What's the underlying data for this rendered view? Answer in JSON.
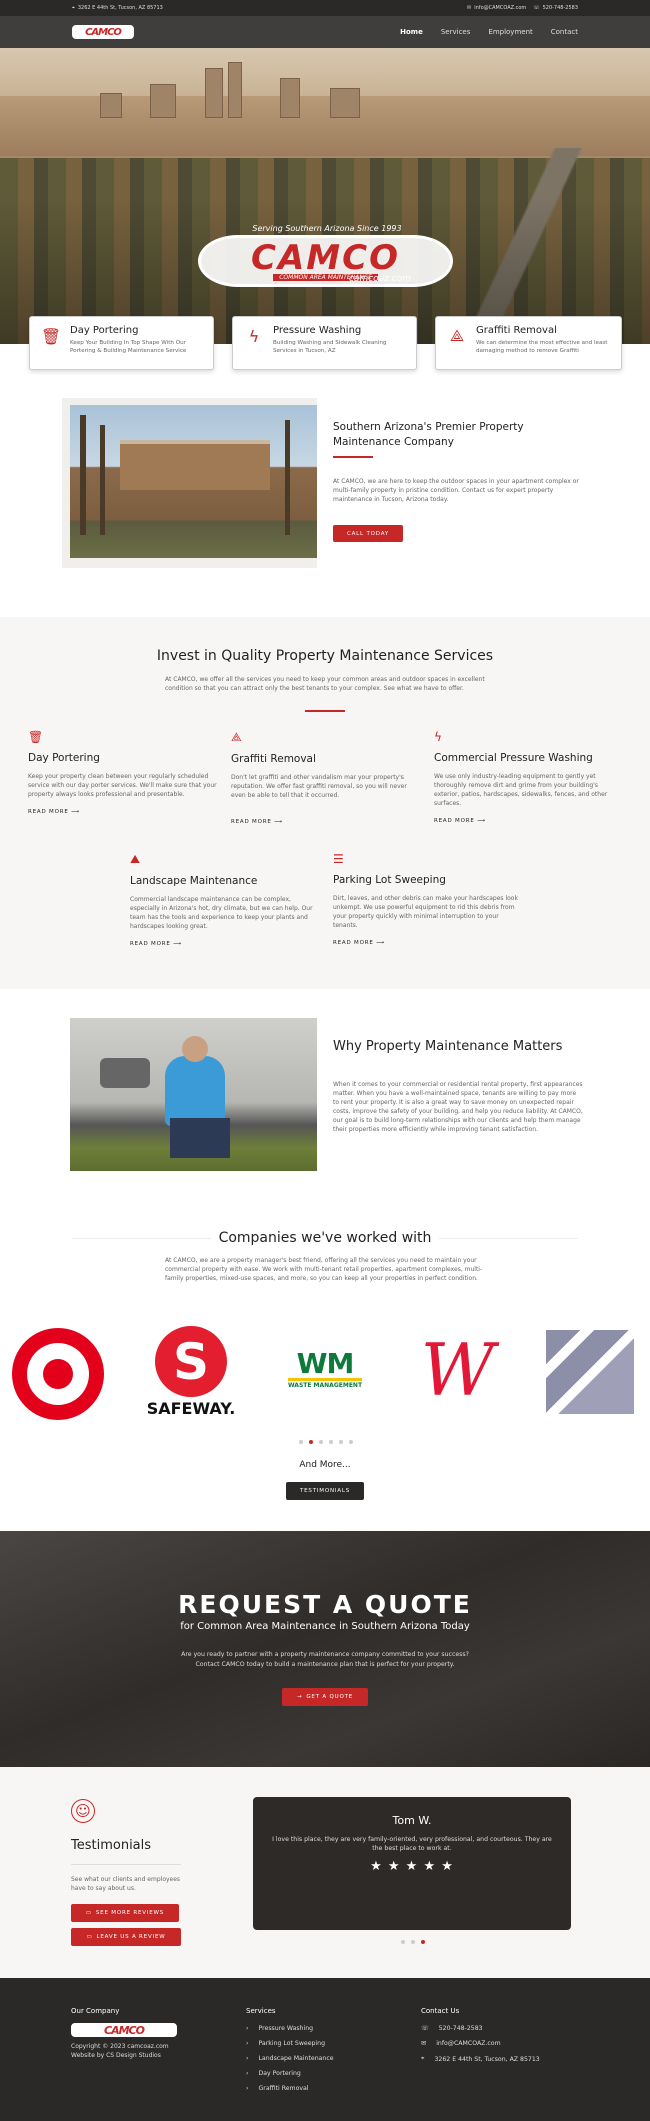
{
  "topbar": {
    "address": "3262 E 44th St, Tucson, AZ 85713",
    "email": "info@CAMCOAZ.com",
    "phone": "520-748-2583"
  },
  "nav": {
    "logo": "CAMCO",
    "items": [
      "Home",
      "Services",
      "Employment",
      "Contact"
    ]
  },
  "hero": {
    "tagline": "Serving Southern Arizona Since 1993",
    "logo": "CAMCO",
    "logo_sub": "COMMON AREA MAINTENANCE",
    "url": "camcoaz.com"
  },
  "feature_cards": [
    {
      "icon": "trash-icon",
      "title": "Day Portering",
      "text": "Keep Your Building In Top Shape With Our Portering & Building Maintenance Service"
    },
    {
      "icon": "lightning-icon",
      "title": "Pressure Washing",
      "text": "Building Washing and Sidewalk Cleaning Services in Tucson, AZ"
    },
    {
      "icon": "spray-icon",
      "title": "Graffiti Removal",
      "text": "We can determine the most effective and least damaging method to remove Graffiti"
    }
  ],
  "about": {
    "title": "Southern Arizona's Premier Property Maintenance Company",
    "text": "At CAMCO, we are here to keep the outdoor spaces in your apartment complex or multi-family property in pristine condition. Contact us for expert property maintenance in Tucson, Arizona today.",
    "button": "CALL TODAY"
  },
  "invest": {
    "title": "Invest in Quality Property Maintenance Services",
    "text": "At CAMCO, we offer all the services you need to keep your common areas and outdoor spaces in excellent condition so that you can attract only the best tenants to your complex. See what we have to offer.",
    "read_more": "READ MORE",
    "services": [
      {
        "icon": "trash-icon",
        "title": "Day Portering",
        "text": "Keep your property clean between your regularly scheduled service with our day porter services. We'll make sure that your property always looks professional and presentable."
      },
      {
        "icon": "spray-icon",
        "title": "Graffiti Removal",
        "text": "Don't let graffiti and other vandalism mar your property's reputation. We offer fast graffiti removal, so you will never even be able to tell that it occurred."
      },
      {
        "icon": "lightning-icon",
        "title": "Commercial Pressure Washing",
        "text": "We use only industry-leading equipment to gently yet thoroughly remove dirt and grime from your building's exterior, patios, hardscapes, sidewalks, fences, and other surfaces."
      },
      {
        "icon": "landscape-icon",
        "title": "Landscape Maintenance",
        "text": "Commercial landscape maintenance can be complex, especially in Arizona's hot, dry climate, but we can help. Our team has the tools and experience to keep your plants and hardscapes looking great."
      },
      {
        "icon": "sweep-icon",
        "title": "Parking Lot Sweeping",
        "text": "Dirt, leaves, and other debris can make your hardscapes look unkempt. We use powerful equipment to rid this debris from your property quickly with minimal interruption to your tenants."
      }
    ]
  },
  "why": {
    "title": "Why Property Maintenance Matters",
    "text": "When it comes to your commercial or residential rental property, first appearances matter. When you have a well-maintained space, tenants are willing to pay more to rent your property. It is also a great way to save money on unexpected repair costs, improve the safety of your building, and help you reduce liability. At CAMCO, our goal is to build long-term relationships with our clients and help them manage their properties more efficiently while improving tenant satisfaction."
  },
  "companies": {
    "title": "Companies we've worked with",
    "text": "At CAMCO, we are a property manager's best friend, offering all the services you need to maintain your commercial property with ease. We work with multi-tenant retail properties, apartment complexes, multi-family properties, mixed-use spaces, and more, so you can keep all your properties in perfect condition.",
    "logos": {
      "safeway": "SAFEWAY.",
      "wm": "WM",
      "wm_sub": "WASTE MANAGEMENT",
      "walgreens": "W"
    },
    "and_more": "And More...",
    "button": "TESTIMONIALS"
  },
  "quote": {
    "title": "REQUEST A QUOTE",
    "subtitle": "for Common Area Maintenance in Southern Arizona Today",
    "text": "Are you ready to partner with a property maintenance company committed to your success? Contact CAMCO today to build a maintenance plan that is perfect for your property.",
    "button": "GET A QUOTE"
  },
  "testimonials": {
    "title": "Testimonials",
    "text": "See what our clients and employees have to say about us.",
    "btn_see": "SEE MORE REVIEWS",
    "btn_leave": "LEAVE US A REVIEW",
    "card": {
      "name": "Tom W.",
      "quote": "I love this place, they are very family-oriented, very professional, and courteous. They are the best place to work at.",
      "stars": "★ ★ ★ ★ ★"
    }
  },
  "footer": {
    "company_heading": "Our Company",
    "logo": "CAMCO",
    "copyright": "Copyright © 2023 camcoaz.com",
    "credit": "Website by CS Design Studios",
    "services_heading": "Services",
    "services": [
      "Pressure Washing",
      "Parking Lot Sweeping",
      "Landscape Maintenance",
      "Day Portering",
      "Graffiti Removal"
    ],
    "contact_heading": "Contact Us",
    "phone": "520-748-2583",
    "email": "info@CAMCOAZ.com",
    "address": "3262 E 44th St, Tucson, AZ 85713"
  },
  "colors": {
    "accent": "#c62828",
    "dark": "#2b2927"
  }
}
